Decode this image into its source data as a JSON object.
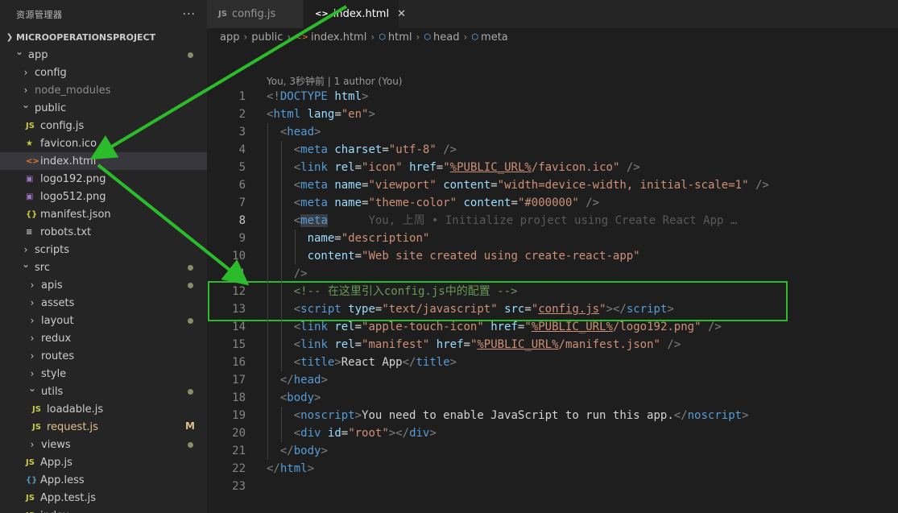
{
  "sidebar": {
    "title": "资源管理器",
    "more": "···",
    "project": "MICROOPERATIONSPROJECT",
    "items": [
      {
        "label": "app",
        "kind": "folder",
        "open": true,
        "depth": 1,
        "dot": true
      },
      {
        "label": "config",
        "kind": "folder",
        "open": false,
        "depth": 2
      },
      {
        "label": "node_modules",
        "kind": "folder",
        "open": false,
        "depth": 2,
        "dim": true
      },
      {
        "label": "public",
        "kind": "folder",
        "open": true,
        "depth": 2
      },
      {
        "label": "config.js",
        "kind": "js",
        "depth": 3
      },
      {
        "label": "favicon.ico",
        "kind": "star",
        "depth": 3
      },
      {
        "label": "index.html",
        "kind": "html",
        "depth": 3,
        "selected": true
      },
      {
        "label": "logo192.png",
        "kind": "img",
        "depth": 3
      },
      {
        "label": "logo512.png",
        "kind": "img",
        "depth": 3
      },
      {
        "label": "manifest.json",
        "kind": "json",
        "depth": 3
      },
      {
        "label": "robots.txt",
        "kind": "txt",
        "depth": 3
      },
      {
        "label": "scripts",
        "kind": "folder",
        "open": false,
        "depth": 2
      },
      {
        "label": "src",
        "kind": "folder",
        "open": true,
        "depth": 2,
        "dot": true
      },
      {
        "label": "apis",
        "kind": "folder",
        "open": false,
        "depth": 3,
        "dot": true
      },
      {
        "label": "assets",
        "kind": "folder",
        "open": false,
        "depth": 3
      },
      {
        "label": "layout",
        "kind": "folder",
        "open": false,
        "depth": 3,
        "dot": true
      },
      {
        "label": "redux",
        "kind": "folder",
        "open": false,
        "depth": 3
      },
      {
        "label": "routes",
        "kind": "folder",
        "open": false,
        "depth": 3
      },
      {
        "label": "style",
        "kind": "folder",
        "open": false,
        "depth": 3
      },
      {
        "label": "utils",
        "kind": "folder",
        "open": true,
        "depth": 3,
        "dot": true
      },
      {
        "label": "loadable.js",
        "kind": "js",
        "depth": 4
      },
      {
        "label": "request.js",
        "kind": "js",
        "depth": 4,
        "modified": "M"
      },
      {
        "label": "views",
        "kind": "folder",
        "open": false,
        "depth": 3,
        "dot": true
      },
      {
        "label": "App.js",
        "kind": "js",
        "depth": 3
      },
      {
        "label": "App.less",
        "kind": "less",
        "depth": 3
      },
      {
        "label": "App.test.js",
        "kind": "js",
        "depth": 3
      },
      {
        "label": "index...",
        "kind": "js",
        "depth": 3
      }
    ]
  },
  "tabs": [
    {
      "label": "config.js",
      "icon": "JS",
      "active": false
    },
    {
      "label": "index.html",
      "icon": "<>",
      "active": true,
      "close": "✕"
    }
  ],
  "breadcrumb": [
    "app",
    "public",
    "index.html",
    "html",
    "head",
    "meta"
  ],
  "codelens": "You, 3秒钟前 | 1 author (You)",
  "current_line": 8,
  "code_lines": [
    [
      [
        "b",
        "<!"
      ],
      [
        "t",
        "DOCTYPE"
      ],
      [
        "x",
        " "
      ],
      [
        "a",
        "html"
      ],
      [
        "b",
        ">"
      ]
    ],
    [
      [
        "b",
        "<"
      ],
      [
        "t",
        "html"
      ],
      [
        "x",
        " "
      ],
      [
        "a",
        "lang"
      ],
      [
        "x",
        "="
      ],
      [
        "s",
        "\"en\""
      ],
      [
        "b",
        ">"
      ]
    ],
    [
      [
        "x",
        "  "
      ],
      [
        "b",
        "<"
      ],
      [
        "t",
        "head"
      ],
      [
        "b",
        ">"
      ]
    ],
    [
      [
        "x",
        "    "
      ],
      [
        "b",
        "<"
      ],
      [
        "t",
        "meta"
      ],
      [
        "x",
        " "
      ],
      [
        "a",
        "charset"
      ],
      [
        "x",
        "="
      ],
      [
        "s",
        "\"utf-8\""
      ],
      [
        "x",
        " "
      ],
      [
        "b",
        "/>"
      ]
    ],
    [
      [
        "x",
        "    "
      ],
      [
        "b",
        "<"
      ],
      [
        "t",
        "link"
      ],
      [
        "x",
        " "
      ],
      [
        "a",
        "rel"
      ],
      [
        "x",
        "="
      ],
      [
        "s",
        "\"icon\""
      ],
      [
        "x",
        " "
      ],
      [
        "a",
        "href"
      ],
      [
        "x",
        "="
      ],
      [
        "s",
        "\""
      ],
      [
        "su",
        "%PUBLIC_URL%"
      ],
      [
        "s",
        "/favicon.ico\""
      ],
      [
        "x",
        " "
      ],
      [
        "b",
        "/>"
      ]
    ],
    [
      [
        "x",
        "    "
      ],
      [
        "b",
        "<"
      ],
      [
        "t",
        "meta"
      ],
      [
        "x",
        " "
      ],
      [
        "a",
        "name"
      ],
      [
        "x",
        "="
      ],
      [
        "s",
        "\"viewport\""
      ],
      [
        "x",
        " "
      ],
      [
        "a",
        "content"
      ],
      [
        "x",
        "="
      ],
      [
        "s",
        "\"width=device-width, initial-scale=1\""
      ],
      [
        "x",
        " "
      ],
      [
        "b",
        "/>"
      ]
    ],
    [
      [
        "x",
        "    "
      ],
      [
        "b",
        "<"
      ],
      [
        "t",
        "meta"
      ],
      [
        "x",
        " "
      ],
      [
        "a",
        "name"
      ],
      [
        "x",
        "="
      ],
      [
        "s",
        "\"theme-color\""
      ],
      [
        "x",
        " "
      ],
      [
        "a",
        "content"
      ],
      [
        "x",
        "="
      ],
      [
        "s",
        "\"#000000\""
      ],
      [
        "x",
        " "
      ],
      [
        "b",
        "/>"
      ]
    ],
    [
      [
        "x",
        "    "
      ],
      [
        "b",
        "<"
      ],
      [
        "th",
        "meta"
      ],
      [
        "g",
        "      You, 上周 • Initialize project using Create React App …"
      ]
    ],
    [
      [
        "x",
        "      "
      ],
      [
        "a",
        "name"
      ],
      [
        "x",
        "="
      ],
      [
        "s",
        "\"description\""
      ]
    ],
    [
      [
        "x",
        "      "
      ],
      [
        "a",
        "content"
      ],
      [
        "x",
        "="
      ],
      [
        "s",
        "\"Web site created using create-react-app\""
      ]
    ],
    [
      [
        "x",
        "    "
      ],
      [
        "b",
        "/>"
      ]
    ],
    [
      [
        "x",
        "    "
      ],
      [
        "c",
        "<!-- 在这里引入config.js中的配置 -->"
      ]
    ],
    [
      [
        "x",
        "    "
      ],
      [
        "b",
        "<"
      ],
      [
        "t",
        "script"
      ],
      [
        "x",
        " "
      ],
      [
        "a",
        "type"
      ],
      [
        "x",
        "="
      ],
      [
        "s",
        "\"text/javascript\""
      ],
      [
        "x",
        " "
      ],
      [
        "a",
        "src"
      ],
      [
        "x",
        "="
      ],
      [
        "s",
        "\""
      ],
      [
        "su",
        "config.js"
      ],
      [
        "s",
        "\""
      ],
      [
        "b",
        "></"
      ],
      [
        "t",
        "script"
      ],
      [
        "b",
        ">"
      ]
    ],
    [
      [
        "x",
        "    "
      ],
      [
        "b",
        "<"
      ],
      [
        "t",
        "link"
      ],
      [
        "x",
        " "
      ],
      [
        "a",
        "rel"
      ],
      [
        "x",
        "="
      ],
      [
        "s",
        "\"apple-touch-icon\""
      ],
      [
        "x",
        " "
      ],
      [
        "a",
        "href"
      ],
      [
        "x",
        "="
      ],
      [
        "s",
        "\""
      ],
      [
        "su",
        "%PUBLIC_URL%"
      ],
      [
        "s",
        "/logo192.png\""
      ],
      [
        "x",
        " "
      ],
      [
        "b",
        "/>"
      ]
    ],
    [
      [
        "x",
        "    "
      ],
      [
        "b",
        "<"
      ],
      [
        "t",
        "link"
      ],
      [
        "x",
        " "
      ],
      [
        "a",
        "rel"
      ],
      [
        "x",
        "="
      ],
      [
        "s",
        "\"manifest\""
      ],
      [
        "x",
        " "
      ],
      [
        "a",
        "href"
      ],
      [
        "x",
        "="
      ],
      [
        "s",
        "\""
      ],
      [
        "su",
        "%PUBLIC_URL%"
      ],
      [
        "s",
        "/manifest.json\""
      ],
      [
        "x",
        " "
      ],
      [
        "b",
        "/>"
      ]
    ],
    [
      [
        "x",
        "    "
      ],
      [
        "b",
        "<"
      ],
      [
        "t",
        "title"
      ],
      [
        "b",
        ">"
      ],
      [
        "x",
        "React App"
      ],
      [
        "b",
        "</"
      ],
      [
        "t",
        "title"
      ],
      [
        "b",
        ">"
      ]
    ],
    [
      [
        "x",
        "  "
      ],
      [
        "b",
        "</"
      ],
      [
        "t",
        "head"
      ],
      [
        "b",
        ">"
      ]
    ],
    [
      [
        "x",
        "  "
      ],
      [
        "b",
        "<"
      ],
      [
        "t",
        "body"
      ],
      [
        "b",
        ">"
      ]
    ],
    [
      [
        "x",
        "    "
      ],
      [
        "b",
        "<"
      ],
      [
        "t",
        "noscript"
      ],
      [
        "b",
        ">"
      ],
      [
        "x",
        "You need to enable JavaScript to run this app."
      ],
      [
        "b",
        "</"
      ],
      [
        "t",
        "noscript"
      ],
      [
        "b",
        ">"
      ]
    ],
    [
      [
        "x",
        "    "
      ],
      [
        "b",
        "<"
      ],
      [
        "t",
        "div"
      ],
      [
        "x",
        " "
      ],
      [
        "a",
        "id"
      ],
      [
        "x",
        "="
      ],
      [
        "s",
        "\"root\""
      ],
      [
        "b",
        "></"
      ],
      [
        "t",
        "div"
      ],
      [
        "b",
        ">"
      ]
    ],
    [
      [
        "x",
        "  "
      ],
      [
        "b",
        "</"
      ],
      [
        "t",
        "body"
      ],
      [
        "b",
        ">"
      ]
    ],
    [
      [
        "b",
        "</"
      ],
      [
        "t",
        "html"
      ],
      [
        "b",
        ">"
      ]
    ],
    [
      [
        "x",
        ""
      ]
    ]
  ],
  "highlighted_lines": [
    12,
    13
  ],
  "colors": {
    "arrow": "#2bbb2b",
    "highlight_box": "#2bbb2b",
    "js_icon": "#cbcb41",
    "html_icon": "#e37933",
    "json_icon": "#cbcb41",
    "img_icon": "#a074c4",
    "star_icon": "#cbcb41",
    "less_icon": "#519aba",
    "modified": "#e2c08d",
    "folder_dot": "#8c8c6a"
  }
}
